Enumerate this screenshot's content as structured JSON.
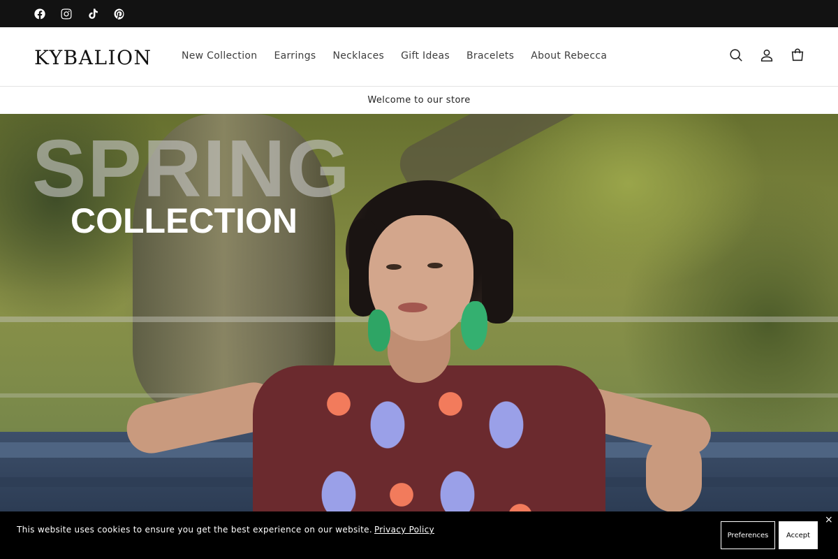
{
  "social": {
    "icons": [
      "facebook-icon",
      "instagram-icon",
      "tiktok-icon",
      "pinterest-icon"
    ]
  },
  "header": {
    "logo": "KYBALION",
    "nav": [
      "New Collection",
      "Earrings",
      "Necklaces",
      "Gift Ideas",
      "Bracelets",
      "About Rebecca"
    ],
    "icons": [
      "search-icon",
      "account-icon",
      "cart-icon"
    ]
  },
  "announcement": "Welcome to our store",
  "hero": {
    "title_big": "SPRING",
    "title_small": "COLLECTION"
  },
  "cookie": {
    "text": "This website uses cookies to ensure you get the best experience on our website.",
    "link": "Privacy Policy",
    "preferences": "Preferences",
    "accept": "Accept",
    "close": "×"
  },
  "colors": {
    "topbar": "#121212",
    "cookie_bg": "#000000",
    "text": "#222222"
  }
}
